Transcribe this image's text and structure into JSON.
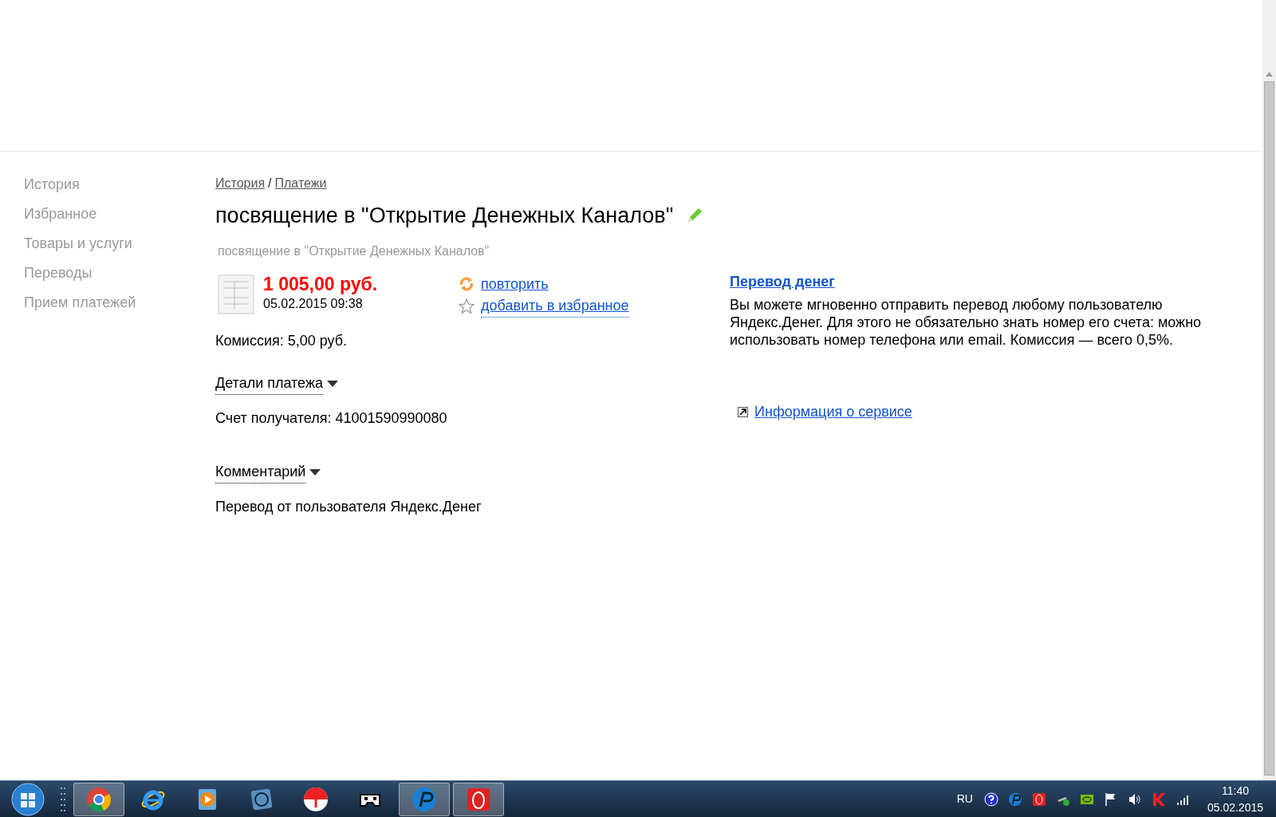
{
  "sidebar": {
    "items": [
      {
        "label": "История"
      },
      {
        "label": "Избранное"
      },
      {
        "label": "Товары и услуги"
      },
      {
        "label": "Переводы"
      },
      {
        "label": "Прием платежей"
      }
    ]
  },
  "breadcrumb": {
    "items": [
      "История",
      "Платежи"
    ],
    "separator": "/"
  },
  "title": "посвящение в \"Открытие Денежных Каналов\"",
  "subtitle": "посвящение в \"Открытие Денежных Каналов\"",
  "payment": {
    "amount": "1 005,00 руб.",
    "datetime": "05.02.2015 09:38",
    "commission": "Комиссия: 5,00 руб."
  },
  "actions": [
    {
      "kind": "repeat",
      "label": "повторить"
    },
    {
      "kind": "favorite",
      "label": "добавить в избранное"
    }
  ],
  "sections": [
    {
      "title": "Детали платежа",
      "expanded": true,
      "body": "Счет получателя: 41001590990080"
    },
    {
      "title": "Комментарий",
      "expanded": true,
      "body": "Перевод от пользователя Яндекс.Денег"
    }
  ],
  "promo": {
    "title": "Перевод денег",
    "text": "Вы можете мгновенно отправить перевод любому пользователю Яндекс.Денег. Для этого не обязательно знать номер его счета: можно использовать номер телефона или email. Комиссия — всего 0,5%.",
    "link": "Информация о сервисе"
  },
  "taskbar": {
    "apps": [
      {
        "kind": "chrome",
        "running": true
      },
      {
        "kind": "ie",
        "running": false
      },
      {
        "kind": "player",
        "running": false
      },
      {
        "kind": "film",
        "running": false
      },
      {
        "kind": "yabrowser",
        "running": false
      },
      {
        "kind": "gamepad",
        "running": false
      },
      {
        "kind": "pclient",
        "running": true
      },
      {
        "kind": "opera",
        "running": true
      }
    ],
    "tray": {
      "language": "RU",
      "time": "11:40",
      "date": "05.02.2015"
    }
  }
}
